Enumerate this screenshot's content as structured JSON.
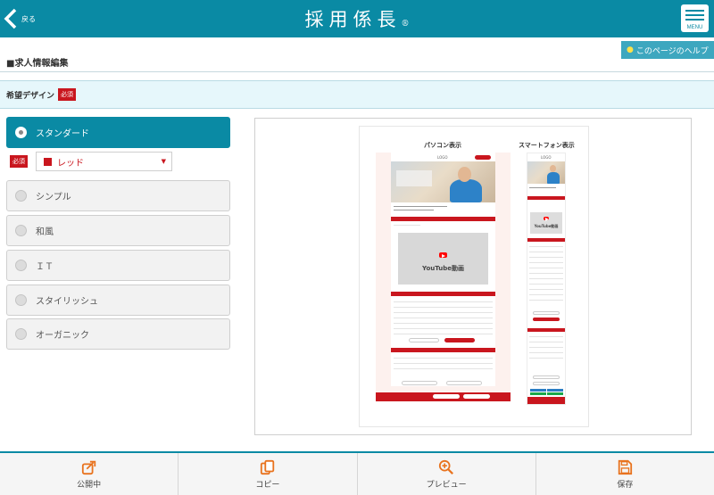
{
  "header": {
    "back_label": "戻る",
    "app_title": "採用係長",
    "app_title_mark": "®",
    "menu_label": "MENU"
  },
  "help_button": {
    "label": "このページのヘルプ"
  },
  "page_title": "■求人情報編集",
  "section": {
    "label": "希望デザイン",
    "required_badge": "必須"
  },
  "design_options": [
    {
      "label": "スタンダード",
      "selected": true
    },
    {
      "label": "シンプル",
      "selected": false
    },
    {
      "label": "和風",
      "selected": false
    },
    {
      "label": "ＩＴ",
      "selected": false
    },
    {
      "label": "スタイリッシュ",
      "selected": false
    },
    {
      "label": "オーガニック",
      "selected": false
    }
  ],
  "color_select": {
    "required_badge": "必須",
    "value": "レッド",
    "swatch_color": "#c9161e"
  },
  "preview": {
    "pc_title": "パソコン表示",
    "sp_title": "スマートフォン表示",
    "pc_logo": "LOGO",
    "sp_logo": "LOGO",
    "pc_video_label": "YouTube動画",
    "sp_video_label": "YouTube動画",
    "accent_color": "#c9161e"
  },
  "toolbar": {
    "items": [
      {
        "label": "公開中",
        "icon": "publish-icon"
      },
      {
        "label": "コピー",
        "icon": "copy-icon"
      },
      {
        "label": "プレビュー",
        "icon": "zoom-in-icon"
      },
      {
        "label": "保存",
        "icon": "save-icon"
      }
    ],
    "icon_color": "#e8731e"
  },
  "colors": {
    "brand": "#0a8aa4",
    "required": "#c9161e"
  }
}
